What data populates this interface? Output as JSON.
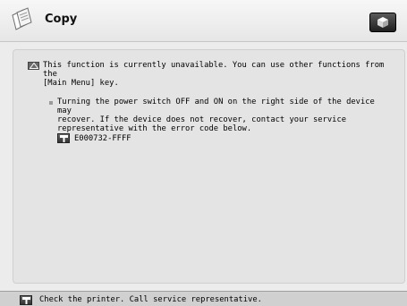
{
  "header": {
    "title": "Copy",
    "app_icon": "copy-documents-icon",
    "home_icon": "main-menu-cube-icon"
  },
  "message": {
    "warning_icon": "warning-triangle-icon",
    "warning_text": "This function is currently unavailable. You can use other functions from the\n[Main Menu] key.",
    "instruction_text": "Turning the power switch OFF and ON on the right side of the device may\nrecover. If the device does not recover, contact your service\nrepresentative with the error code below.",
    "error_icon": "wrench-service-icon",
    "error_code": "E000732-FFFF"
  },
  "status_bar": {
    "icon": "wrench-service-icon",
    "text": "Check the printer. Call service representative."
  },
  "colors": {
    "background": "#ececec",
    "panel": "#e4e4e4",
    "header": "#f0f0f0",
    "status_bar": "#d0d0d0",
    "button": "#2a2a2a"
  }
}
